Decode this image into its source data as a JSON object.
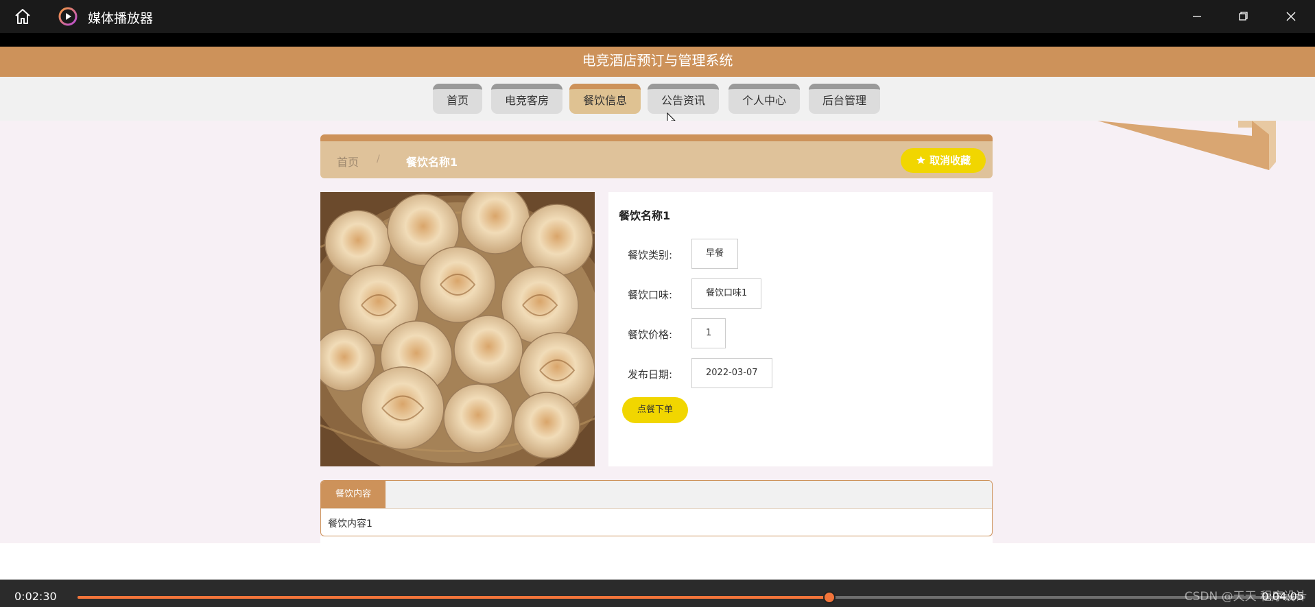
{
  "window": {
    "title": "媒体播放器",
    "icons": {
      "home": "home-icon",
      "logo": "media-player-logo-icon",
      "minimize": "minimize-icon",
      "restore": "restore-icon",
      "close": "close-icon"
    }
  },
  "site": {
    "title": "电竞酒店预订与管理系统",
    "colors": {
      "accent": "#cd925a",
      "button": "#f1d600"
    }
  },
  "nav": {
    "items": [
      {
        "label": "首页"
      },
      {
        "label": "电竞客房"
      },
      {
        "label": "餐饮信息",
        "active": true
      },
      {
        "label": "公告资讯"
      },
      {
        "label": "个人中心"
      },
      {
        "label": "后台管理"
      }
    ]
  },
  "breadcrumb": {
    "home": "首页",
    "separator": "/",
    "current": "餐饮名称1",
    "favorite_label": "取消收藏",
    "favorite_icon": "star-icon"
  },
  "detail": {
    "name": "餐饮名称1",
    "fields": [
      {
        "label": "餐饮类别:",
        "value": "早餐"
      },
      {
        "label": "餐饮口味:",
        "value": "餐饮口味1"
      },
      {
        "label": "餐饮价格:",
        "value": "1"
      },
      {
        "label": "发布日期:",
        "value": "2022-03-07"
      }
    ],
    "order_button": "点餐下单",
    "image_subject": "food-photo"
  },
  "tabs": {
    "active_label": "餐饮内容",
    "content": "餐饮内容1"
  },
  "player": {
    "current_time": "0:02:30",
    "end_time": "0:04:05",
    "progress": 0.6124,
    "watermark": "CSDN @天天 程序设计"
  }
}
